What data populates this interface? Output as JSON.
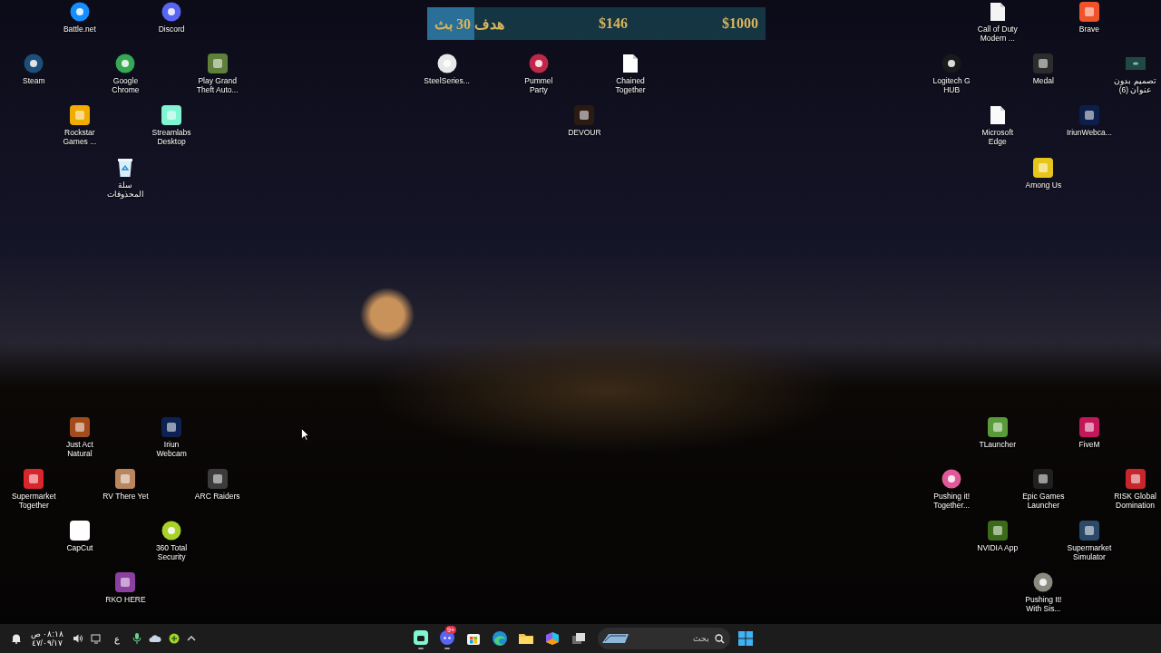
{
  "desktop": {
    "icons": [
      {
        "label": "Battle.net",
        "kind": "round",
        "color": "#148eff"
      },
      {
        "label": "Discord",
        "kind": "round",
        "color": "#5865f2"
      },
      {
        "label": "Steam",
        "kind": "round",
        "color": "#1e4e7a"
      },
      {
        "label": "Google Chrome",
        "kind": "round",
        "color": "#34a853"
      },
      {
        "label": "Play Grand Theft Auto...",
        "kind": "square",
        "color": "#5f7f3a"
      },
      {
        "label": "Rockstar Games ...",
        "kind": "square",
        "color": "#f2ab00"
      },
      {
        "label": "Streamlabs Desktop",
        "kind": "square",
        "color": "#80f5d2"
      },
      {
        "label": "سلة المحذوفات",
        "kind": "recycle-bin",
        "color": "#d8eef8"
      },
      {
        "label": "SteelSeries...",
        "kind": "round",
        "color": "#e8e8e8"
      },
      {
        "label": "Pummel Party",
        "kind": "round",
        "color": "#c0284a"
      },
      {
        "label": "Chained Together",
        "kind": "document",
        "color": "#ffffff"
      },
      {
        "label": "DEVOUR",
        "kind": "square",
        "color": "#2a1a14"
      },
      {
        "label": "Call of Duty Modern ...",
        "kind": "document",
        "color": "#f4f4f4"
      },
      {
        "label": "Brave",
        "kind": "square",
        "color": "#f0532a"
      },
      {
        "label": "Logitech G HUB",
        "kind": "round",
        "color": "#1a1a1a"
      },
      {
        "label": "Medal",
        "kind": "square",
        "color": "#2c2c2c"
      },
      {
        "label": "تصميم بدون عنوان (6)",
        "kind": "thumbnail",
        "color": "#1f4a44"
      },
      {
        "label": "Microsoft Edge",
        "kind": "document",
        "color": "#fafafa"
      },
      {
        "label": "IriunWebca...",
        "kind": "square",
        "color": "#0c1f4a"
      },
      {
        "label": "Among Us",
        "kind": "square",
        "color": "#e8c51a"
      },
      {
        "label": "Just Act Natural",
        "kind": "square",
        "color": "#a34b1c"
      },
      {
        "label": "Iriun Webcam",
        "kind": "square",
        "color": "#0d2252"
      },
      {
        "label": "Supermarket Together",
        "kind": "square",
        "color": "#d8262c"
      },
      {
        "label": "RV There Yet",
        "kind": "square",
        "color": "#b9865e"
      },
      {
        "label": "ARC Raiders",
        "kind": "square",
        "color": "#3b3b3b"
      },
      {
        "label": "CapCut",
        "kind": "square",
        "color": "#ffffff"
      },
      {
        "label": "360 Total Security",
        "kind": "round",
        "color": "#a8d12a"
      },
      {
        "label": "RKO HERE",
        "kind": "square",
        "color": "#8b3fa0"
      },
      {
        "label": "TLauncher",
        "kind": "square",
        "color": "#5a9a3a"
      },
      {
        "label": "FiveM",
        "kind": "square",
        "color": "#c2185b"
      },
      {
        "label": "Pushing it! Together...",
        "kind": "round",
        "color": "#e05a9a"
      },
      {
        "label": "Epic Games Launcher",
        "kind": "square",
        "color": "#202020"
      },
      {
        "label": "RISK Global Domination",
        "kind": "square",
        "color": "#c8262c"
      },
      {
        "label": "NVIDIA App",
        "kind": "square",
        "color": "#3a6a1a"
      },
      {
        "label": "Supermarket Simulator",
        "kind": "square",
        "color": "#2b4a6a"
      },
      {
        "label": "Pushing It! With Sis...",
        "kind": "round",
        "color": "#8a8a80"
      }
    ]
  },
  "goal": {
    "label": "هدف 30 بث",
    "current": "$146",
    "target": "$1000",
    "level": 0.14
  },
  "taskbar": {
    "pinned": [
      {
        "kind": "streamlabs",
        "running": true
      },
      {
        "kind": "discord",
        "running": true,
        "badge": "9+"
      },
      {
        "kind": "store",
        "running": false
      },
      {
        "kind": "edge",
        "running": false
      },
      {
        "kind": "explorer",
        "running": false
      },
      {
        "kind": "m365",
        "running": false
      },
      {
        "kind": "taskview",
        "running": false
      }
    ],
    "search": {
      "placeholder": "بحث"
    },
    "language": "ع",
    "clock": {
      "time": "٠٨:١٨ ص",
      "date": "٤٧/٠٩/١٧"
    }
  }
}
